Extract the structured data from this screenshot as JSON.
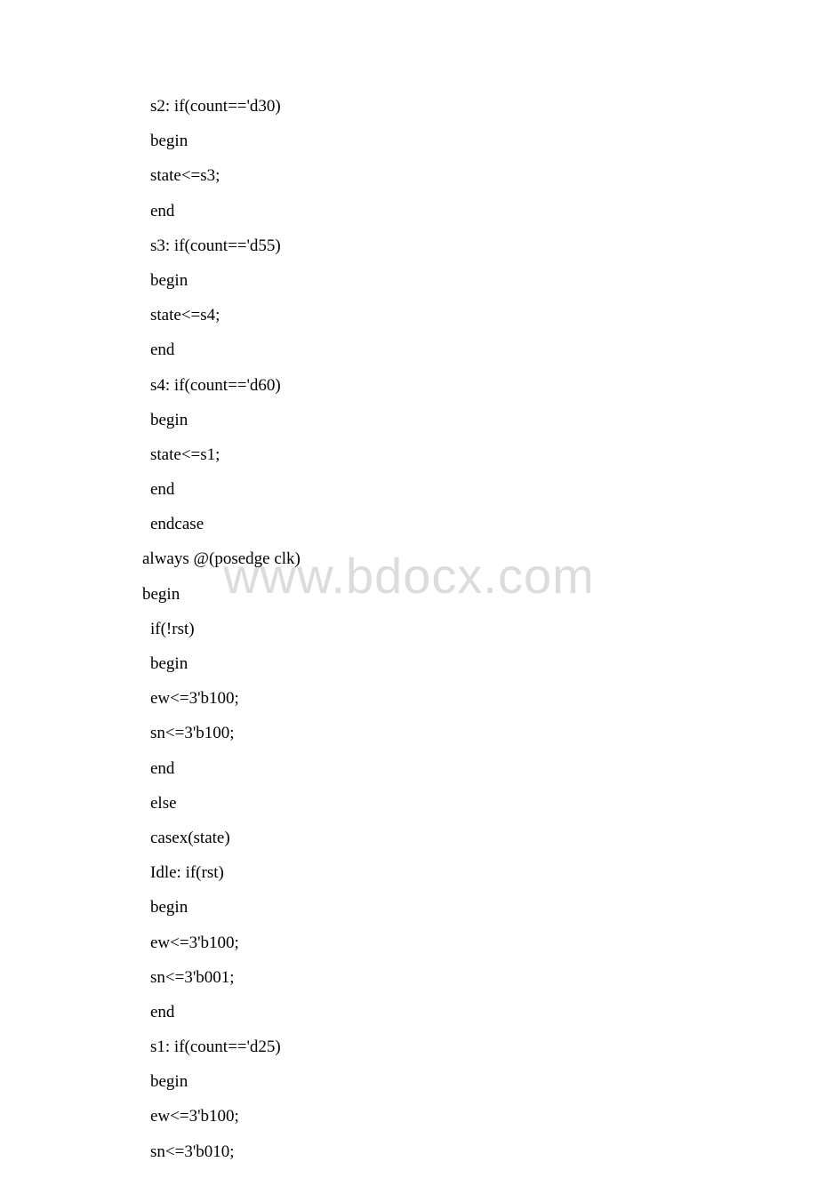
{
  "watermark": "www.bdocx.com",
  "lines": [
    {
      "indent": 1,
      "text": "s2: if(count=='d30)"
    },
    {
      "indent": 1,
      "text": "begin"
    },
    {
      "indent": 1,
      "text": "state<=s3;"
    },
    {
      "indent": 1,
      "text": "end"
    },
    {
      "indent": 1,
      "text": "s3: if(count=='d55)"
    },
    {
      "indent": 1,
      "text": "begin"
    },
    {
      "indent": 1,
      "text": "state<=s4;"
    },
    {
      "indent": 1,
      "text": "end"
    },
    {
      "indent": 1,
      "text": "s4: if(count=='d60)"
    },
    {
      "indent": 1,
      "text": "begin"
    },
    {
      "indent": 1,
      "text": "state<=s1;"
    },
    {
      "indent": 1,
      "text": "end"
    },
    {
      "indent": 1,
      "text": "endcase"
    },
    {
      "indent": 0,
      "text": "always @(posedge clk)"
    },
    {
      "indent": 0,
      "text": "begin"
    },
    {
      "indent": 1,
      "text": "if(!rst)"
    },
    {
      "indent": 1,
      "text": "begin"
    },
    {
      "indent": 1,
      "text": "ew<=3'b100;"
    },
    {
      "indent": 1,
      "text": "sn<=3'b100;"
    },
    {
      "indent": 1,
      "text": "end"
    },
    {
      "indent": 1,
      "text": "else"
    },
    {
      "indent": 1,
      "text": "casex(state)"
    },
    {
      "indent": 1,
      "text": "Idle: if(rst)"
    },
    {
      "indent": 1,
      "text": "begin"
    },
    {
      "indent": 1,
      "text": "ew<=3'b100;"
    },
    {
      "indent": 1,
      "text": "sn<=3'b001;"
    },
    {
      "indent": 1,
      "text": "end"
    },
    {
      "indent": 1,
      "text": "s1: if(count=='d25)"
    },
    {
      "indent": 1,
      "text": "begin"
    },
    {
      "indent": 1,
      "text": "ew<=3'b100;"
    },
    {
      "indent": 1,
      "text": "sn<=3'b010;"
    }
  ]
}
